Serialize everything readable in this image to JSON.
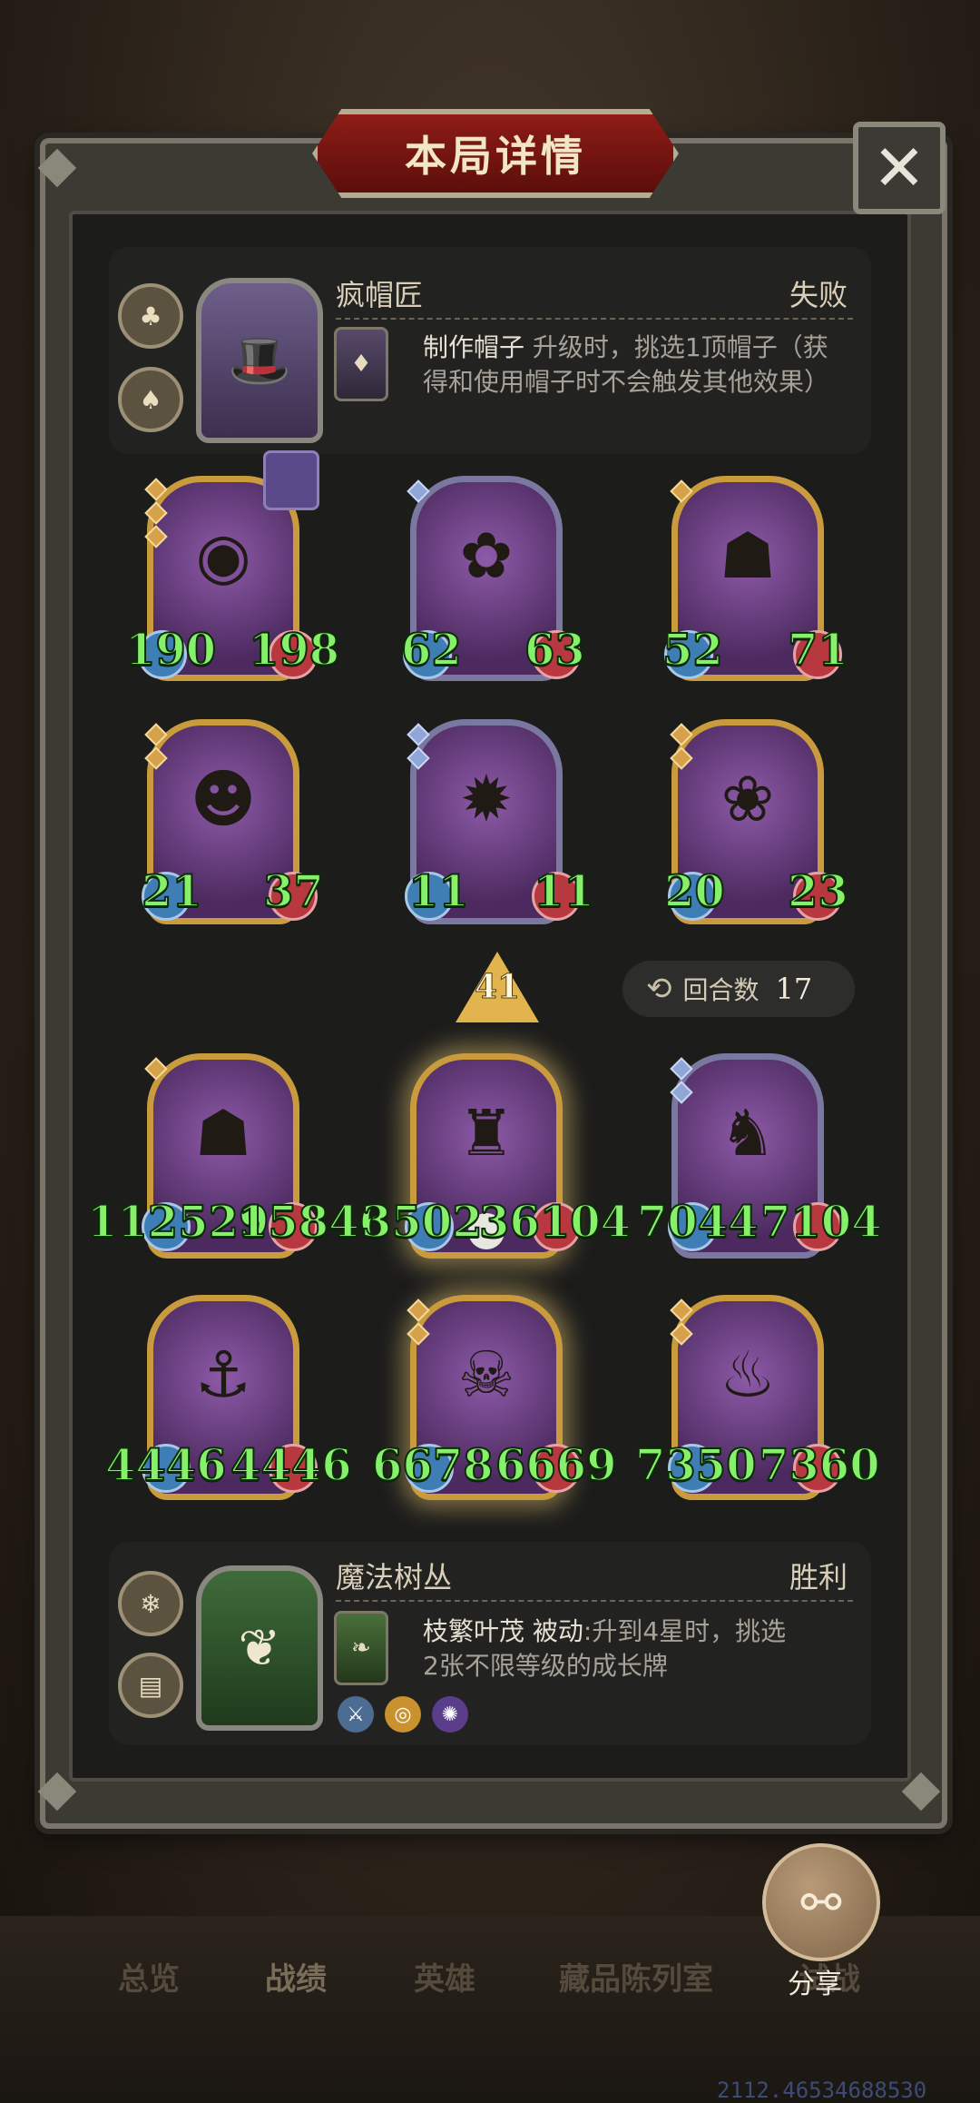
{
  "dialog": {
    "title": "本局详情",
    "close_icon": "✕"
  },
  "top_hero": {
    "name": "疯帽匠",
    "result": "失败",
    "skill_name": "制作帽子",
    "skill_desc_line1": " 升级时，挑选1顶帽子（获",
    "skill_desc_line2": "得和使用帽子时不会触发其他效果）"
  },
  "top_board": [
    {
      "atk": "190",
      "hp": "198"
    },
    {
      "atk": "62",
      "hp": "63"
    },
    {
      "atk": "52",
      "hp": "71"
    },
    {
      "atk": "21",
      "hp": "37"
    },
    {
      "atk": "11",
      "hp": "11"
    },
    {
      "atk": "20",
      "hp": "23"
    }
  ],
  "middle": {
    "level": "41",
    "round_label": "回合数",
    "round_value": "17"
  },
  "bottom_board_row1_text": [
    "112529",
    "15846",
    "3502",
    "36104",
    "7044",
    "7104"
  ],
  "bottom_board_row2_text": [
    "4446",
    "4446",
    "6678",
    "6669",
    "7350",
    "7360"
  ],
  "bottom_hero": {
    "name": "魔法树丛",
    "result": "胜利",
    "skill_name": "枝繁叶茂",
    "skill_type": " 被动",
    "skill_desc_line1": ":升到4星时，挑选",
    "skill_desc_line2": "2张不限等级的成长牌"
  },
  "nav": {
    "tabs": [
      "总览",
      "战绩",
      "英雄",
      "藏品陈列室",
      "试战"
    ],
    "share_label": "分享"
  },
  "footer_id": "2112.46534688530",
  "colors": {
    "stat_green": "#86f06b",
    "gold_frame": "#c99b3c",
    "title_red": "#8e1c17"
  }
}
